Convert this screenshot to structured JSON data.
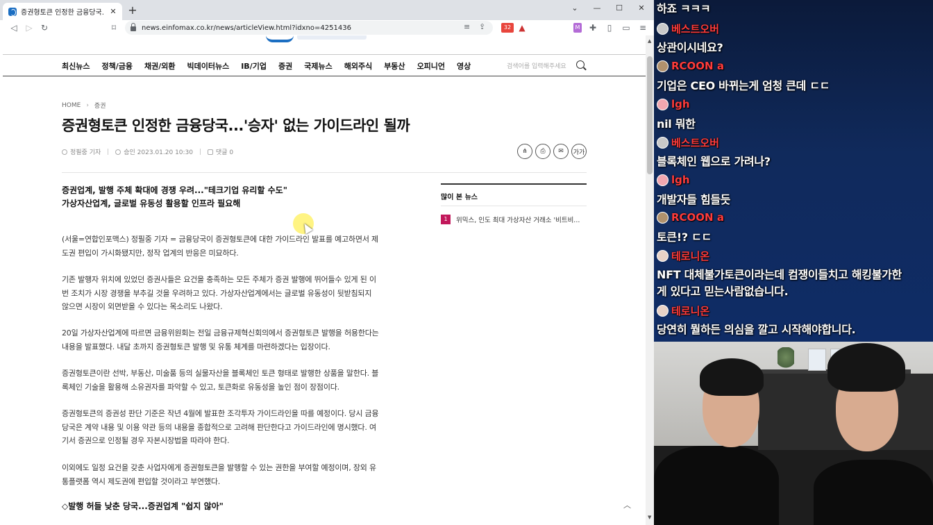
{
  "browser": {
    "tab_title": "증권형토큰 인정한 금융당국...'승자",
    "tab_close": "✕",
    "new_tab": "+",
    "url": "news.einfomax.co.kr/news/articleView.html?idxno=4251436",
    "extension_badge": "32",
    "window_controls": {
      "collapse": "⌄",
      "minimize": "—",
      "maximize": "☐",
      "close": "✕"
    }
  },
  "site": {
    "nav": [
      "최신뉴스",
      "정책/금융",
      "채권/외환",
      "빅데이터뉴스",
      "IB/기업",
      "증권",
      "국제뉴스",
      "해외주식",
      "부동산",
      "오피니언",
      "영상"
    ],
    "search_placeholder": "검색어를 입력해주세요"
  },
  "article": {
    "breadcrumb": [
      "HOME",
      "증권"
    ],
    "headline": "증권형토큰 인정한 금융당국...'승자' 없는 가이드라인 될까",
    "author": "정필중 기자",
    "published": "승인 2023.01.20 10:30",
    "comments": "댓글 0",
    "action_font_label": "가가",
    "subheads": [
      "증권업계, 발행 주체 확대에 경쟁 우려...\"테크기업 유리할 수도\"",
      "가상자산업계, 글로벌 유동성 활용할 인프라 필요해"
    ],
    "paragraphs": [
      [
        "(서울=연합인포맥스) 정필중 기자 = 금융당국이 증권형토큰에 대한 가이드라인 발표를 예고하면서 제",
        "도권 편입이 가시화됐지만, 정작 업계의 반응은 미묘하다."
      ],
      [
        "기존 발행자 위치에 있었던 증권사들은 요건을 충족하는 모든 주체가 증권 발행에 뛰어들수 있게 된 이",
        "번 조치가 시장 경쟁을 부추길 것을 우려하고 있다. 가상자산업계에서는 글로벌 유동성이 뒷받침되지",
        "않으면 시장이 외면받을 수 있다는 목소리도 나왔다."
      ],
      [
        "20일 가상자산업계에 따르면 금융위원회는 전일 금융규제혁신회의에서 증권형토큰 발행을 허용한다는",
        "내용을 발표했다. 내달 초까지 증권형토큰 발행 및 유통 체계를 마련하겠다는 입장이다."
      ],
      [
        "증권형토큰이란 선박, 부동산, 미술품 등의 실물자산을 블록체인 토큰 형태로 발행한 상품을 말한다. 블",
        "록체인 기술을 활용해 소유권자를 파악할 수 있고, 토큰화로 유동성을 높인 점이 장점이다."
      ],
      [
        "증권형토큰의 증권성 판단 기준은 작년 4월에 발표한 조각투자 가이드라인을 따를 예정이다. 당시 금융",
        "당국은 계약 내용 및 이용 약관 등의 내용을 종합적으로 고려해 판단한다고 가이드라인에 명시했다. 여",
        "기서 증권으로 인정될 경우 자본시장법을 따라야 한다."
      ],
      [
        "이외에도 일정 요건을 갖춘 사업자에게 증권형토큰을 발행할 수 있는 권한을 부여할 예정이며, 장외 유",
        "통플랫폼 역시 제도권에 편입할 것이라고 부연했다."
      ]
    ],
    "section_title": "◇발행 허들 낮춘 당국...증권업계 \"쉽지 않아\""
  },
  "sidebar": {
    "popular_title": "많이 본 뉴스",
    "popular_items": [
      {
        "rank": "1",
        "title": "위믹스, 인도 최대 가상자산 거래소 '비트비..."
      }
    ]
  },
  "chat": {
    "messages": [
      {
        "user": "",
        "text": "하죠 ㅋㅋㅋ"
      },
      {
        "user": "베스트오버",
        "text": "상관이시네요?"
      },
      {
        "user": "RCOON a",
        "text": "기업은 CEO 바뀌는게 엄청 큰데 ㄷㄷ"
      },
      {
        "user": "lgh",
        "text": "nil 뭐한"
      },
      {
        "user": "베스트오버",
        "text": "블록체인 웹으로 가려나?"
      },
      {
        "user": "lgh",
        "text": "개발자들 힘들듯"
      },
      {
        "user": "RCOON a",
        "text": "토큰!? ㄷㄷ"
      },
      {
        "user": "테로니온",
        "text": "NFT 대체불가토큰이라는데 컴쟁이들치고 해킹불가한",
        "text2": "게 있다고 믿는사람없습니다."
      },
      {
        "user": "테로니온",
        "text": "당연히 뭘하든 의심을 깔고 시작해야합니다."
      }
    ]
  },
  "colors": {
    "accent": "#1b6ec2",
    "rank_badge": "#c2185b",
    "chat_username": "#ff3b3b",
    "chat_bg": "#102a5c"
  }
}
